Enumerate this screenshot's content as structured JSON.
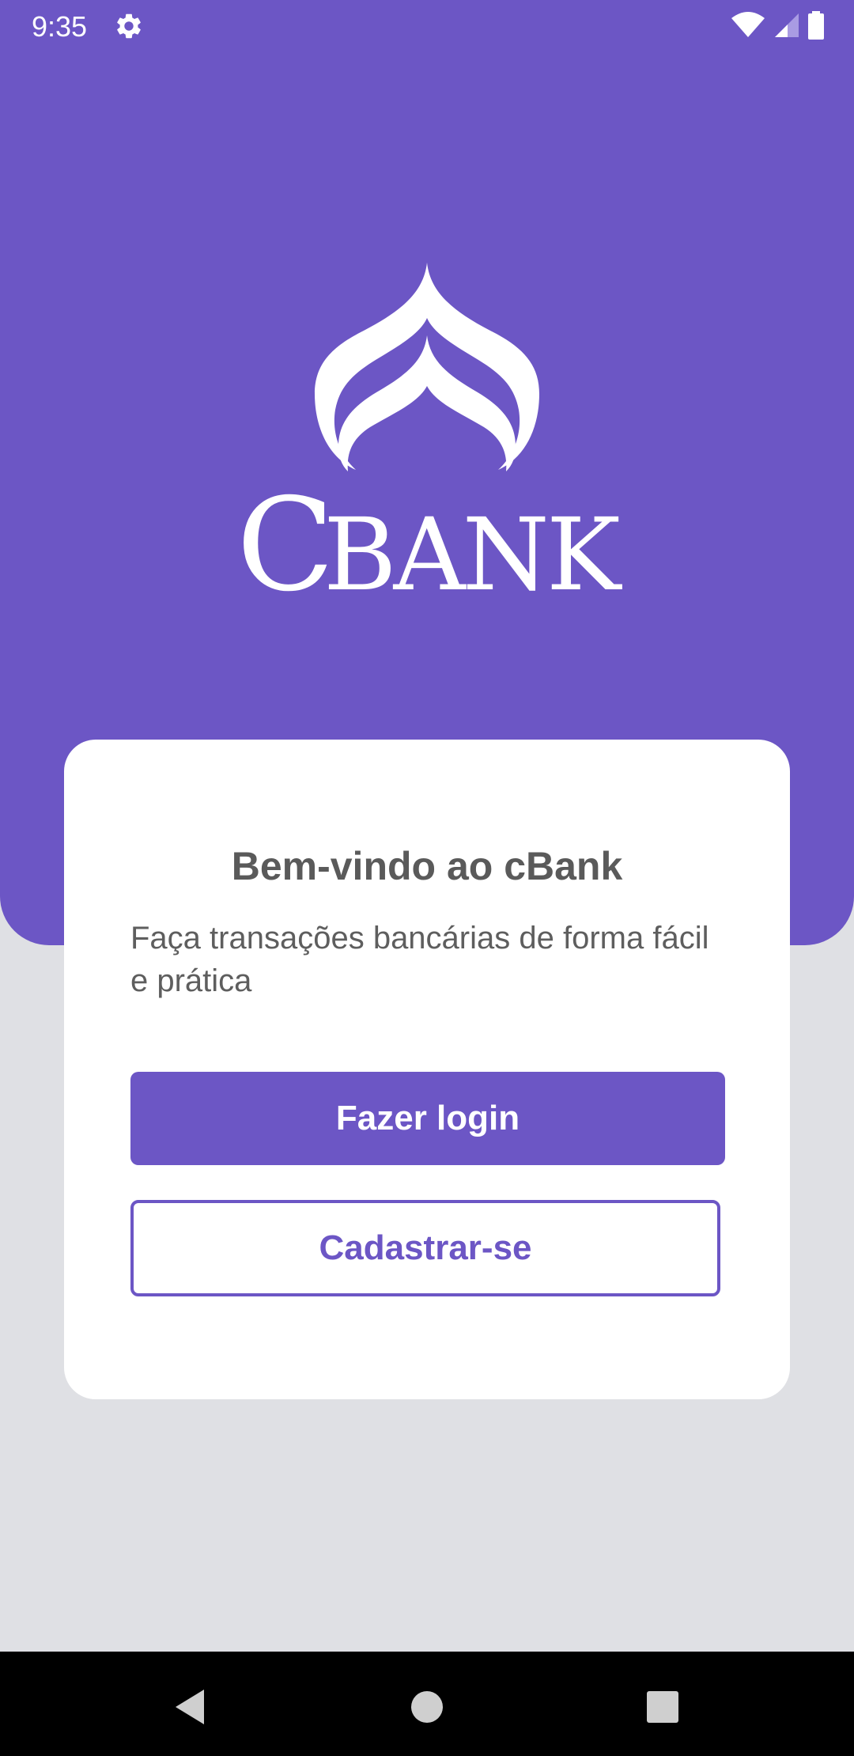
{
  "status_bar": {
    "time": "9:35",
    "icons": [
      "settings-gear-icon",
      "wifi-icon",
      "cellular-signal-icon",
      "battery-icon"
    ]
  },
  "brand": {
    "logo_icon": "cbank-logo-icon",
    "name_initial": "C",
    "name_rest": "BANK"
  },
  "welcome_card": {
    "title": "Bem-vindo ao cBank",
    "subtitle": "Faça transações bancárias de forma fácil e prática",
    "login_button": "Fazer login",
    "signup_button": "Cadastrar-se"
  },
  "nav_bar": {
    "icons": [
      "back-triangle-icon",
      "home-circle-icon",
      "recents-square-icon"
    ]
  },
  "colors": {
    "primary": "#6C56C5",
    "background": "#DFE0E4",
    "card": "#FFFFFF",
    "text": "#5A5A5A"
  }
}
